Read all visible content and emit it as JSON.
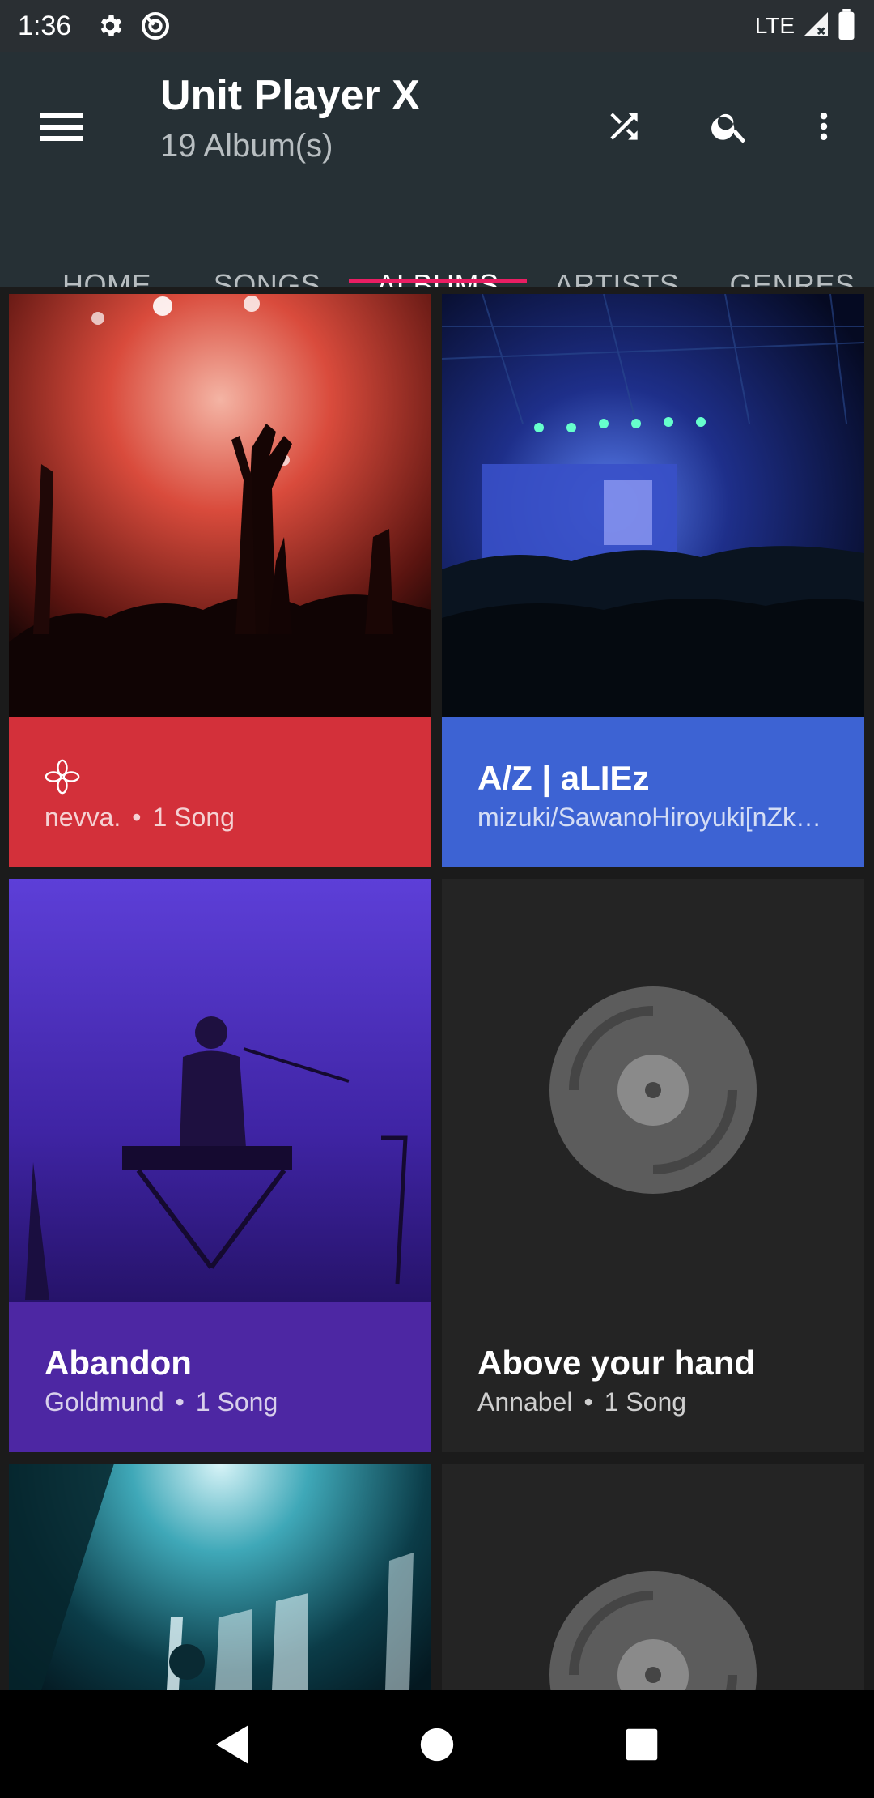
{
  "status_bar": {
    "time": "1:36",
    "network": "LTE"
  },
  "app_bar": {
    "title": "Unit Player X",
    "subtitle": "19 Album(s)",
    "icons": [
      "menu-icon",
      "shuffle-icon",
      "search-icon",
      "more-vert-icon"
    ]
  },
  "tabs": [
    {
      "label": "HOME"
    },
    {
      "label": "SONGS"
    },
    {
      "label": "ALBUMS",
      "active": true
    },
    {
      "label": "ARTISTS"
    },
    {
      "label": "GENRES"
    }
  ],
  "albums": [
    {
      "title": "",
      "artist": "nevva.",
      "songs": "1 Song",
      "color": "#d3303a",
      "title_icon": "flower-icon"
    },
    {
      "title": "A/Z | aLIEz",
      "artist": "mizuki/SawanoHiroyuki[nZk…",
      "songs": "",
      "color": "#3d63d3"
    },
    {
      "title": "Abandon",
      "artist": "Goldmund",
      "songs": "1 Song",
      "color": "#4d27a3"
    },
    {
      "title": "Above your hand",
      "artist": "Annabel",
      "songs": "1 Song",
      "color": "#242424"
    }
  ],
  "colors": {
    "accent": "#e91e63",
    "app_bar": "#263035",
    "status_bar": "#2a2f33"
  }
}
